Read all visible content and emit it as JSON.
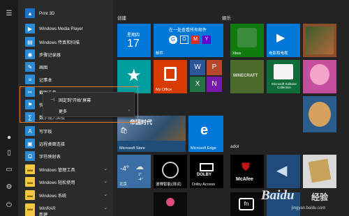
{
  "apps": [
    {
      "label": "Print 3D",
      "icon": "print3d-icon"
    },
    {
      "label": "Windows Media Player",
      "icon": "media-player-icon"
    },
    {
      "label": "Windows 传真和扫描",
      "icon": "fax-scan-icon"
    },
    {
      "label": "步骤记录器",
      "icon": "steps-recorder-icon"
    },
    {
      "label": "画图",
      "icon": "paint-icon"
    },
    {
      "label": "记事本",
      "icon": "notepad-icon"
    },
    {
      "label": "截图工具",
      "icon": "snipping-tool-icon"
    },
    {
      "label": "快速助手",
      "icon": "quick-assist-icon"
    },
    {
      "label": "数学输入面板",
      "icon": "math-input-icon"
    },
    {
      "label": "写字板",
      "icon": "wordpad-icon"
    },
    {
      "label": "远程桌面连接",
      "icon": "remote-desktop-icon"
    },
    {
      "label": "字符映射表",
      "icon": "character-map-icon"
    },
    {
      "label": "Windows 管理工具",
      "icon": "folder-icon",
      "folder": true
    },
    {
      "label": "Windows 轻松使用",
      "icon": "folder-icon",
      "folder": true
    },
    {
      "label": "Windows 系统",
      "icon": "folder-icon",
      "folder": true
    },
    {
      "label": "WinRAR",
      "icon": "folder-icon",
      "folder": true
    },
    {
      "label": "新建",
      "icon": "folder-icon",
      "folder": true
    }
  ],
  "context_menu": {
    "pin_label": "固定到\"开始\"屏幕",
    "more_label": "更多"
  },
  "groups": {
    "create": "创建",
    "play": "娱乐",
    "adol": "adol"
  },
  "tiles": {
    "calendar_day": "星期四",
    "calendar_date": "17",
    "mail_banner": "在一处查看所有邮件",
    "mail_label": "邮件",
    "office_label": "My Office",
    "xbox_label": "Xbox",
    "movies_label": "电影和电视",
    "minecraft_label": "MINECRAFT",
    "solitaire_label": "Microsoft Solitaire Collection",
    "store_title": "帝国时代",
    "store_label": "Microsoft Store",
    "edge_label": "Microsoft Edge",
    "weather_temp": "-4°",
    "weather_hi": "1°",
    "weather_lo": "-4°",
    "weather_city": "北京",
    "cortana_label": "波禅智能(测试)",
    "dolby_label": "Dolby Access",
    "mcafee_label": "McAfee",
    "fn_label": "fn"
  },
  "watermark": {
    "brand": "Baidu",
    "cn": "经验",
    "url": "jingyan.baidu.com"
  },
  "colors": {
    "accent_blue": "#0078d7",
    "highlight_orange": "#e97b2b",
    "office_red": "#d83b01",
    "folder_yellow": "#f2c744"
  }
}
